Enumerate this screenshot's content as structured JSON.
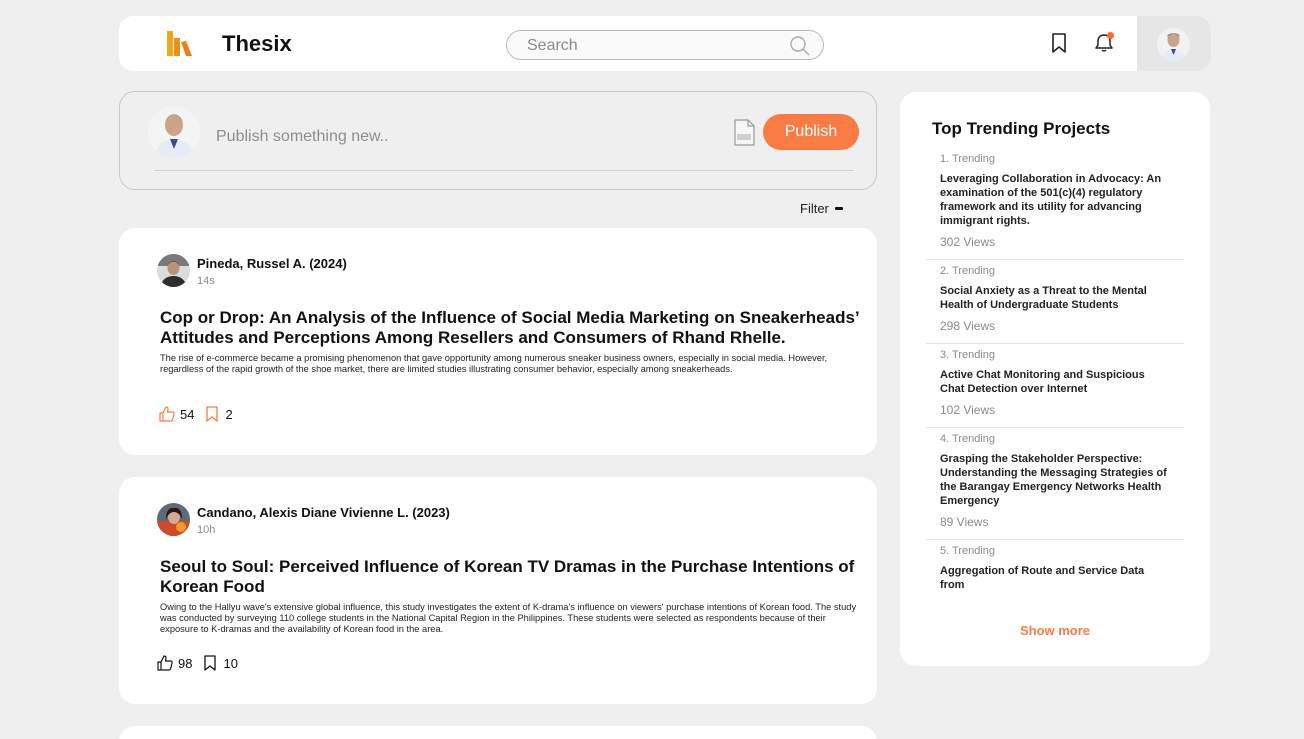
{
  "header": {
    "brand": "Thesix",
    "search_placeholder": "Search"
  },
  "composer": {
    "placeholder": "Publish something new..",
    "publish_label": "Publish"
  },
  "filter": {
    "label": "Filter"
  },
  "posts": [
    {
      "author": "Pineda, Russel A. (2024)",
      "time": "14s",
      "title": "Cop or Drop: An Analysis of the Influence of Social Media Marketing on Sneakerheads’ Attitudes and Perceptions Among Resellers and Consumers of Rhand Rhelle.",
      "abstract": "The rise of e-commerce became a promising phenomenon that gave opportunity among numerous sneaker business owners, especially in social media. However, regardless of the rapid growth of the shoe market, there are limited studies illustrating consumer behavior, especially among sneakerheads.",
      "likes": "54",
      "saves": "2",
      "icon_color": "#fa7b43"
    },
    {
      "author": "Candano, Alexis Diane Vivienne L. (2023)",
      "time": "10h",
      "title": "Seoul to Soul: Perceived Influence of Korean TV Dramas in the Purchase Intentions of Korean Food",
      "abstract": "Owing to the Hallyu wave's extensive global influence, this study investigates the extent of K-drama's influence on viewers' purchase intentions of Korean food. The study was conducted by surveying 110 college students in the National Capital Region in the Philippines. These students were selected as respondents because of their exposure to K-dramas and the availability of Korean food in the area.",
      "likes": "98",
      "saves": "10",
      "icon_color": "#111111"
    }
  ],
  "trending": {
    "heading": "Top Trending Projects",
    "items": [
      {
        "rank": "1. Trending",
        "title": "Leveraging Collaboration in Advocacy: An examination of the 501(c)(4) regulatory framework and its utility for advancing immigrant rights.",
        "views": "302 Views"
      },
      {
        "rank": "2. Trending",
        "title": "Social Anxiety as a Threat to the Mental Health of Undergraduate Students",
        "views": "298 Views"
      },
      {
        "rank": "3. Trending",
        "title": "Active Chat Monitoring and Suspicious Chat Detection over Internet",
        "views": "102 Views"
      },
      {
        "rank": "4. Trending",
        "title": "Grasping the Stakeholder Perspective: Understanding the Messaging Strategies of the Barangay Emergency Networks Health Emergency",
        "views": "89 Views"
      },
      {
        "rank": "5. Trending",
        "title": "Aggregation of Route and Service Data from",
        "views": ""
      }
    ],
    "show_more": "Show more"
  },
  "colors": {
    "accent": "#fa7b43",
    "background": "#efefef",
    "card": "#ffffff"
  }
}
